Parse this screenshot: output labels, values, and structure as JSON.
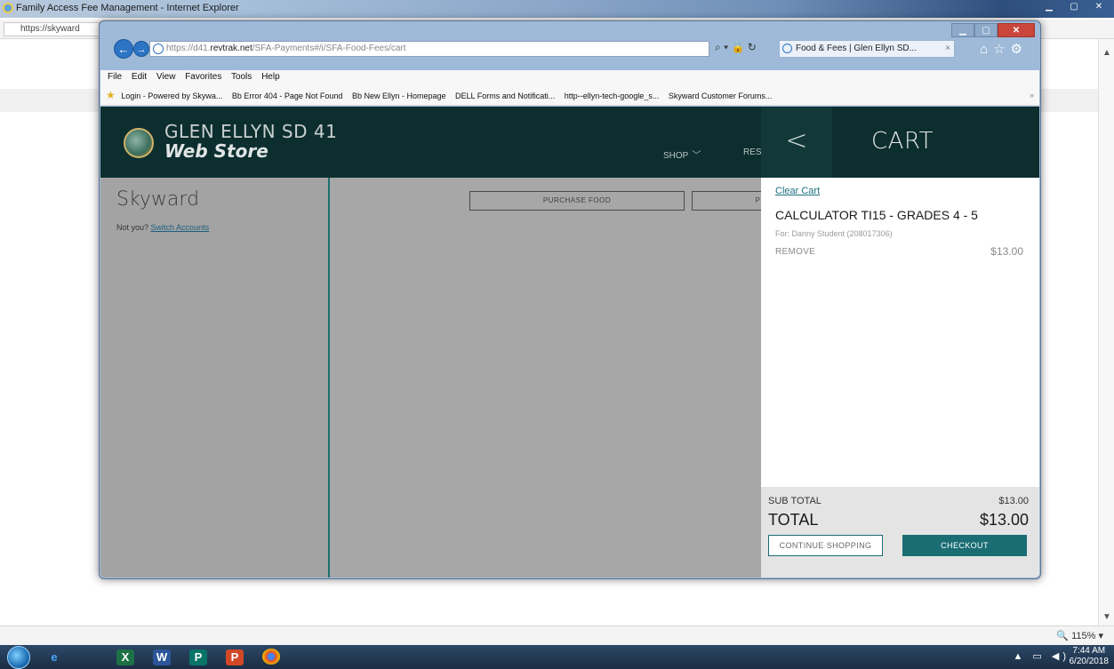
{
  "outer_window": {
    "title": "Family Access Fee Management - Internet Explorer",
    "address": "https://skyward",
    "zoom": "115%"
  },
  "taskbar": {
    "apps": [
      "ie",
      "excel",
      "word",
      "publisher",
      "powerpoint",
      "chrome"
    ],
    "time": "7:44 AM",
    "date": "6/20/2018"
  },
  "browser": {
    "url_prefix": "https://d41.",
    "url_host": "revtrak.net",
    "url_path": "/SFA-Payments#/i/SFA-Food-Fees/cart",
    "tab_title": "Food & Fees | Glen Ellyn SD...",
    "menu": [
      "File",
      "Edit",
      "View",
      "Favorites",
      "Tools",
      "Help"
    ],
    "favorites": [
      "Login - Powered by Skywa...",
      "Bb Error 404 - Page Not Found",
      "Bb New Ellyn - Homepage",
      "DELL Forms and Notificati...",
      "http--ellyn-tech-google_s...",
      "Skyward Customer Forums..."
    ]
  },
  "site": {
    "name_line1": "GLEN ELLYN SD 41",
    "name_line2": "Web Store",
    "nav_shop": "SHOP",
    "nav_res": "RES",
    "sidebar_name": "Skyward",
    "not_you": "Not you?",
    "switch_accounts": "Switch Accounts",
    "purchase_food": "PURCHASE FOOD",
    "second_button_fragment": "P"
  },
  "cart": {
    "back": "<",
    "title": "CART",
    "clear": "Clear Cart",
    "item_name": "CALCULATOR TI15 - GRADES 4 - 5",
    "item_for": "For: Danny Student (208017306)",
    "remove": "REMOVE",
    "item_price": "$13.00",
    "subtotal_label": "SUB TOTAL",
    "subtotal_value": "$13.00",
    "total_label": "TOTAL",
    "total_value": "$13.00",
    "continue_label": "CONTINUE SHOPPING",
    "checkout_label": "CHECKOUT"
  },
  "colors": {
    "header": "#0d2e2e",
    "accent": "#1a6d73",
    "overlay": "#a7a7a7"
  }
}
